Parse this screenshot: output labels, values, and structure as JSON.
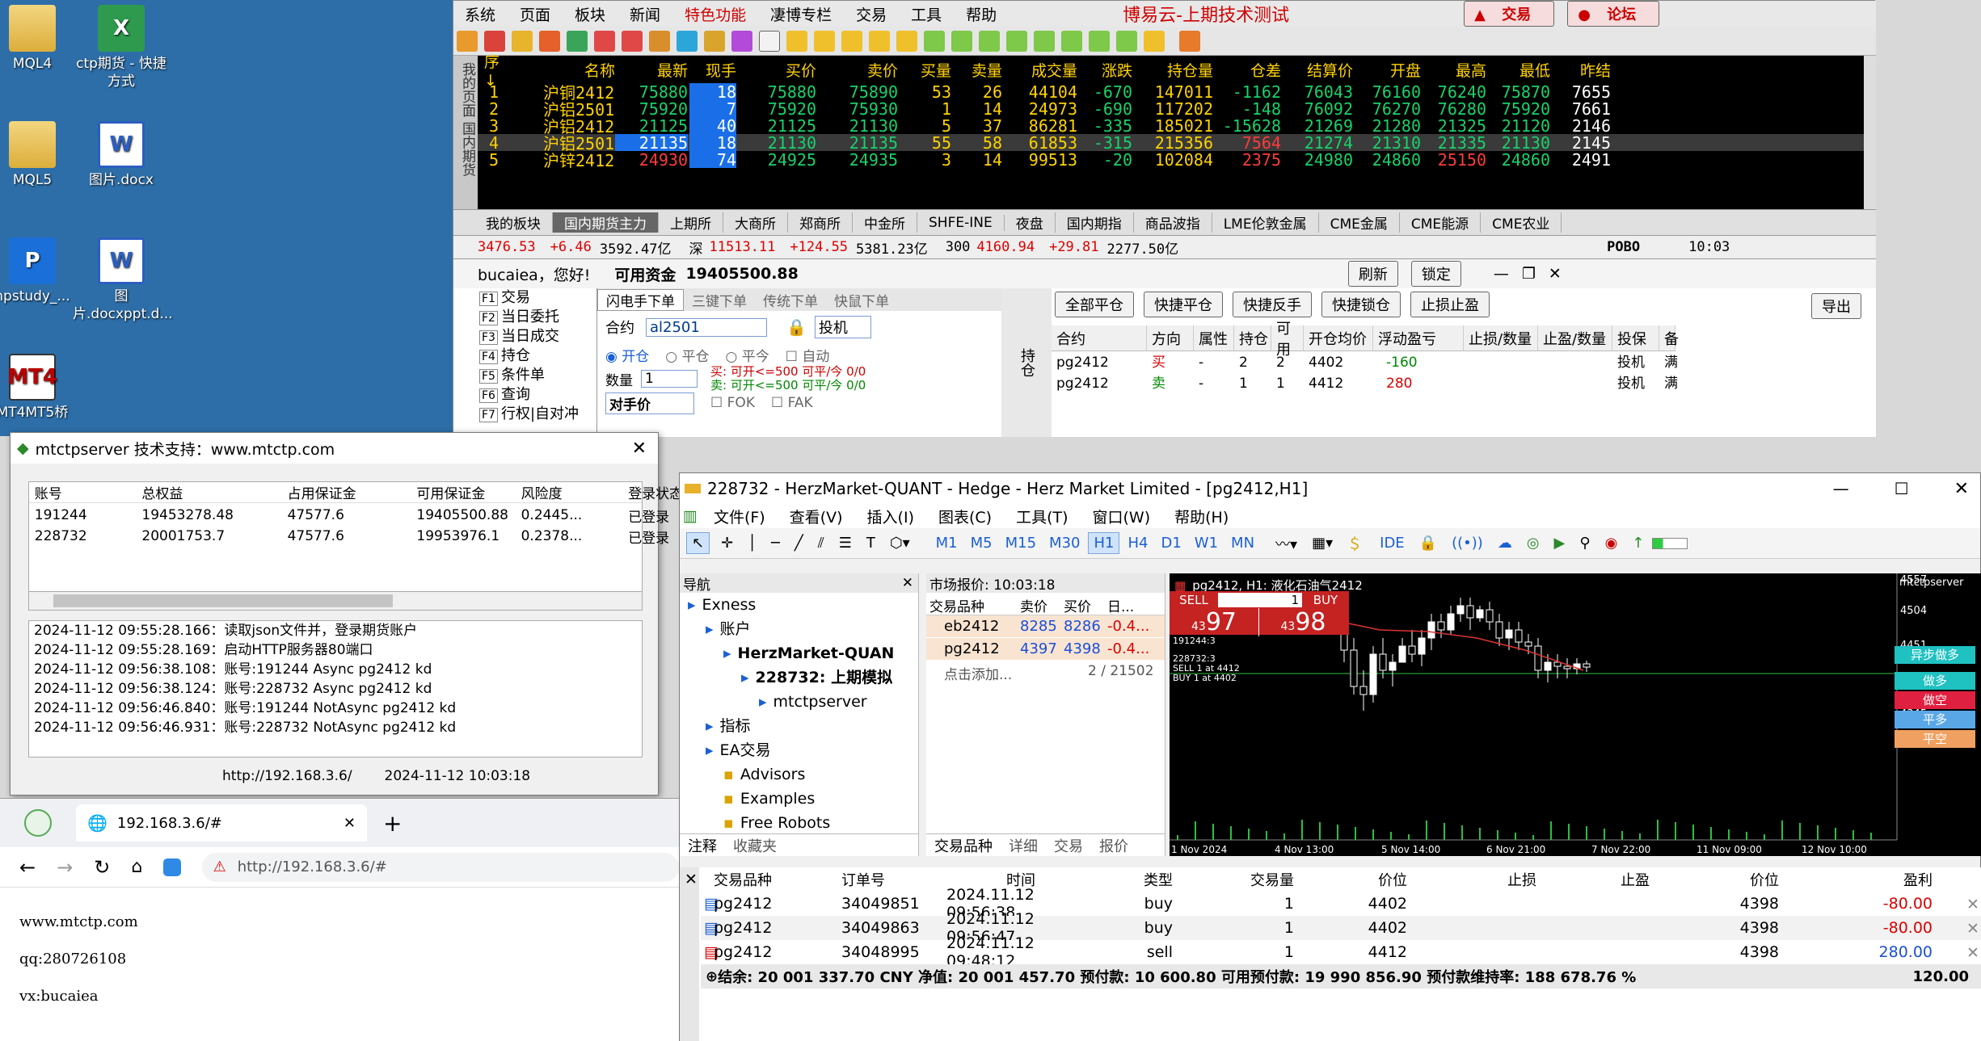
{
  "desktop": {
    "icons": [
      {
        "label": "MQL4"
      },
      {
        "label": "ctp期货 - 快捷方式"
      },
      {
        "label": "MQL5"
      },
      {
        "label": "图片.docx"
      },
      {
        "label": "npstudy_..."
      },
      {
        "label": "图片.docxppt.d..."
      },
      {
        "label": "MT4MT5桥"
      }
    ]
  },
  "broker": {
    "menu": [
      "系统",
      "页面",
      "板块",
      "新闻",
      "特色功能",
      "凄博专栏",
      "交易",
      "工具",
      "帮助"
    ],
    "title": "博易云-上期技术测试",
    "trade_btn": "交易",
    "forum_btn": "论坛",
    "side_tab": "我的页面 国内期货",
    "columns": [
      "序↓",
      "名称",
      "最新",
      "现手",
      "买价",
      "卖价",
      "买量",
      "卖量",
      "成交量",
      "涨跌",
      "持仓量",
      "仓差",
      "结算价",
      "开盘",
      "最高",
      "最低",
      "昨结"
    ],
    "rows": [
      [
        "1",
        "沪铜2412",
        "75880",
        "18",
        "75880",
        "75890",
        "53",
        "26",
        "44104",
        "-670",
        "147011",
        "-1162",
        "76043",
        "76160",
        "76240",
        "75870",
        "7655"
      ],
      [
        "2",
        "沪铝2501",
        "75920",
        "7",
        "75920",
        "75930",
        "1",
        "14",
        "24973",
        "-690",
        "117202",
        "-148",
        "76092",
        "76270",
        "76280",
        "75920",
        "7661"
      ],
      [
        "3",
        "沪铝2412",
        "21125",
        "40",
        "21125",
        "21130",
        "5",
        "37",
        "86281",
        "-335",
        "185021",
        "-15628",
        "21269",
        "21280",
        "21325",
        "21120",
        "2146"
      ],
      [
        "4",
        "沪铝2501",
        "21135",
        "18",
        "21130",
        "21135",
        "55",
        "58",
        "61853",
        "-315",
        "215356",
        "7564",
        "21274",
        "21310",
        "21335",
        "21130",
        "2145"
      ],
      [
        "5",
        "沪锌2412",
        "24930",
        "74",
        "24925",
        "24935",
        "3",
        "14",
        "99513",
        "-20",
        "102084",
        "2375",
        "24980",
        "24860",
        "25150",
        "24860",
        "2491"
      ]
    ],
    "tabs": [
      "我的板块",
      "国内期货主力",
      "上期所",
      "大商所",
      "郑商所",
      "中金所",
      "SHFE-INE",
      "夜盘",
      "国内期指",
      "商品波指",
      "LME伦敦金属",
      "CME金属",
      "CME能源",
      "CME农业"
    ],
    "ticker": [
      "3476.53",
      "+6.46",
      "3592.47亿",
      "深",
      "11513.11",
      "+124.55",
      "5381.23亿",
      "300",
      "4160.94",
      "+29.81",
      "2277.50亿",
      "POBO",
      "10:03"
    ],
    "greeting": "bucaiea，您好!",
    "available_label": "可用资金",
    "available_value": "19405500.88",
    "refresh_btn": "刷新",
    "lock_btn": "锁定",
    "left_menu": [
      {
        "key": "F1",
        "label": "交易"
      },
      {
        "key": "F2",
        "label": "当日委托"
      },
      {
        "key": "F3",
        "label": "当日成交"
      },
      {
        "key": "F4",
        "label": "持仓"
      },
      {
        "key": "F5",
        "label": "条件单"
      },
      {
        "key": "F6",
        "label": "查询"
      },
      {
        "key": "F7",
        "label": "行权|自对冲"
      }
    ],
    "order_tabs": [
      "闪电手下单",
      "三键下单",
      "传统下单",
      "快鼠下单"
    ],
    "contract_label": "合约",
    "contract_value": "al2501",
    "hedge_value": "投机",
    "open_label": "开仓",
    "close_label": "平仓",
    "closetoday_label": "平今",
    "auto_label": "自动",
    "qty_label": "数量",
    "qty_value": "1",
    "buy_info": "买: 可开<=500 可平/今 0/0",
    "sell_info": "卖: 可开<=500 可平/今 0/0",
    "price_type": "对手价",
    "fok": "FOK",
    "fak": "FAK",
    "side_label": "持仓",
    "pos_buttons": [
      "全部平仓",
      "快捷平仓",
      "快捷反手",
      "快捷锁仓",
      "止损止盈"
    ],
    "export_btn": "导出",
    "pos_columns": [
      "合约",
      "方向",
      "属性",
      "持仓",
      "可用",
      "开仓均价",
      "浮动盈亏",
      "止损/数量",
      "止盈/数量",
      "投保",
      "备"
    ],
    "pos_rows": [
      [
        "pg2412",
        "买",
        "-",
        "2",
        "2",
        "4402",
        "-160",
        "",
        "",
        "投机",
        "满"
      ],
      [
        "pg2412",
        "卖",
        "-",
        "1",
        "1",
        "4412",
        "280",
        "",
        "",
        "投机",
        "满"
      ]
    ]
  },
  "mtctp": {
    "title": "mtctpserver 技术支持：www.mtctp.com",
    "columns": [
      "账号",
      "总权益",
      "占用保证金",
      "可用保证金",
      "风险度",
      "登录状态"
    ],
    "rows": [
      [
        "191244",
        "19453278.48",
        "47577.6",
        "19405500.88",
        "0.2445...",
        "已登录"
      ],
      [
        "228732",
        "20001753.7",
        "47577.6",
        "19953976.1",
        "0.2378...",
        "已登录"
      ]
    ],
    "log": [
      "2024-11-12 09:55:28.166：读取json文件并，登录期货账户",
      "2024-11-12 09:55:28.169：启动HTTP服务器80端口",
      "2024-11-12 09:56:38.108：账号:191244 Async pg2412 kd",
      "2024-11-12 09:56:38.124：账号:228732 Async pg2412 kd",
      "2024-11-12 09:56:46.840：账号:191244 NotAsync pg2412 kd",
      "2024-11-12 09:56:46.931：账号:228732 NotAsync pg2412 kd"
    ],
    "url": "http://192.168.3.6/",
    "time": "2024-11-12 10:03:18"
  },
  "browser": {
    "tab": "192.168.3.6/#",
    "address": "http://192.168.3.6/#",
    "lines": [
      "www.mtctp.com",
      "qq:280726108",
      "vx:bucaiea"
    ]
  },
  "mt5": {
    "title": "228732 - HerzMarket-QUANT - Hedge - Herz Market Limited - [pg2412,H1]",
    "menu": [
      "文件(F)",
      "查看(V)",
      "插入(I)",
      "图表(C)",
      "工具(T)",
      "窗口(W)",
      "帮助(H)"
    ],
    "timeframes": [
      "M1",
      "M5",
      "M15",
      "M30",
      "H1",
      "H4",
      "D1",
      "W1",
      "MN"
    ],
    "ide": "IDE",
    "nav_title": "导航",
    "nav": [
      {
        "label": "Exness",
        "lvl": 0
      },
      {
        "label": "账户",
        "lvl": 1
      },
      {
        "label": "HerzMarket-QUAN",
        "lvl": 2
      },
      {
        "label": "228732: 上期模拟",
        "lvl": 3
      },
      {
        "label": "mtctpserver",
        "lvl": 4
      },
      {
        "label": "指标",
        "lvl": 1
      },
      {
        "label": "EA交易",
        "lvl": 1
      },
      {
        "label": "Advisors",
        "lvl": 2
      },
      {
        "label": "Examples",
        "lvl": 2
      },
      {
        "label": "Free Robots",
        "lvl": 2
      }
    ],
    "nav_tabs": [
      "注释",
      "收藏夹"
    ],
    "mw_title": "市场报价: 10:03:18",
    "mw_cols": [
      "交易品种",
      "卖价",
      "买价",
      "日..."
    ],
    "mw_rows": [
      [
        "eb2412",
        "8285",
        "8286",
        "-0.4..."
      ],
      [
        "pg2412",
        "4397",
        "4398",
        "-0.4..."
      ]
    ],
    "mw_add": "点击添加...",
    "mw_count": "2 / 21502",
    "mw_tabs": [
      "交易品种",
      "详细",
      "交易",
      "报价"
    ],
    "chart_title": "pg2412, H1: 液化石油气2412",
    "sell": "SELL",
    "buy": "BUY",
    "lot": "1",
    "bid_small": "43",
    "bid_big": "97",
    "ask_small": "43",
    "ask_big": "98",
    "chart_info": [
      "191244:3",
      "228732:3",
      "SELL 1 at 4412",
      "BUY 1 at 4402"
    ],
    "ea_name": "mtctpserver",
    "price_labels": [
      "4557",
      "4504",
      "4451",
      "4397",
      "4345"
    ],
    "time_labels": [
      "1 Nov 2024",
      "4 Nov 13:00",
      "5 Nov 14:00",
      "6 Nov 21:00",
      "7 Nov 22:00",
      "11 Nov 09:00",
      "12 Nov 10:00"
    ],
    "ea_buttons": [
      "异步做多",
      "做多",
      "做空",
      "平多",
      "平空"
    ],
    "trade_cols": [
      "交易品种",
      "订单号",
      "时间",
      "类型",
      "交易量",
      "价位",
      "止损",
      "止盈",
      "价位",
      "盈利"
    ],
    "trade_rows": [
      [
        "pg2412",
        "34049851",
        "2024.11.12 09:56:38",
        "buy",
        "1",
        "4402",
        "",
        "",
        "4398",
        "-80.00"
      ],
      [
        "pg2412",
        "34049863",
        "2024.11.12 09:56:47",
        "buy",
        "1",
        "4402",
        "",
        "",
        "4398",
        "-80.00"
      ],
      [
        "pg2412",
        "34048995",
        "2024.11.12 09:48:12",
        "sell",
        "1",
        "4412",
        "",
        "",
        "4398",
        "280.00"
      ]
    ],
    "summary": "结余: 20 001 337.70 CNY  净值: 20 001 457.70  预付款: 10 600.80  可用预付款: 19 990 856.90  预付款维持率: 188 678.76 %",
    "summary_profit": "120.00"
  }
}
